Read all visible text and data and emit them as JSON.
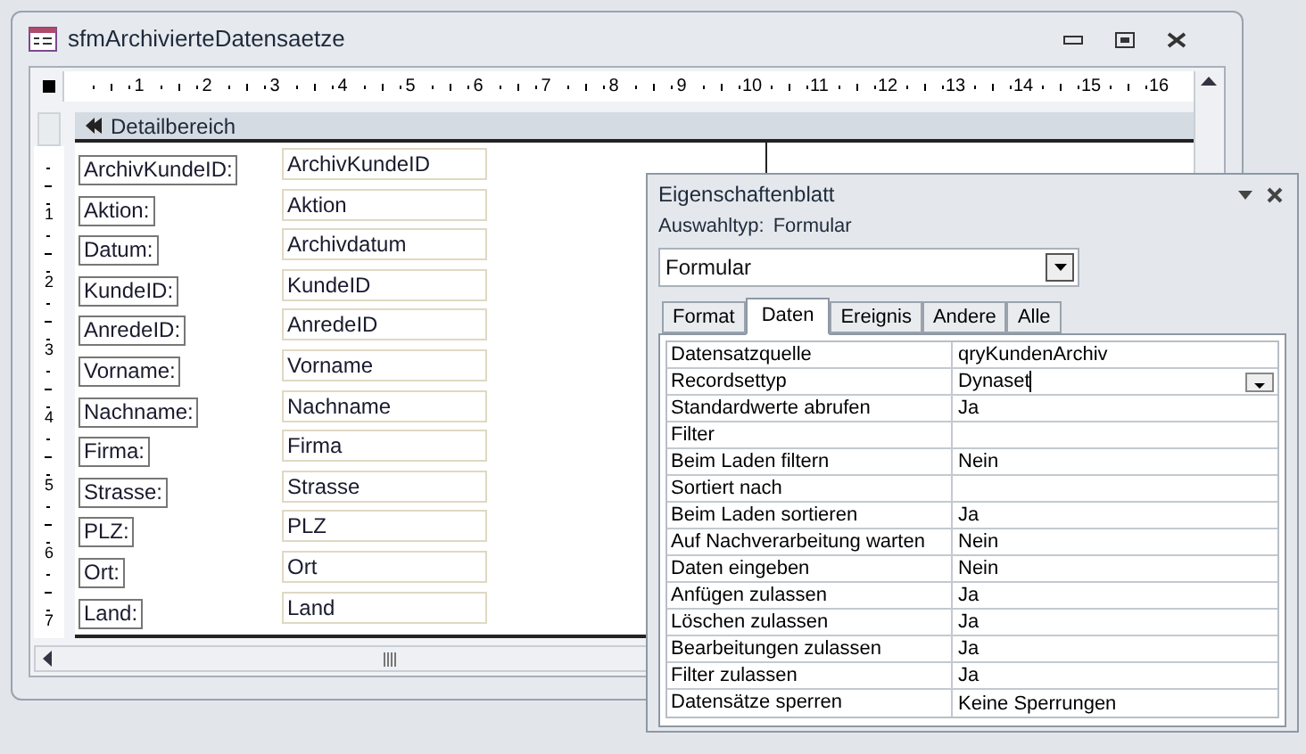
{
  "form_window": {
    "title": "sfmArchivierteDatensaetze",
    "ruler_horizontal": [
      "1",
      "2",
      "3",
      "4",
      "5",
      "6",
      "7",
      "8",
      "9",
      "10",
      "11",
      "12",
      "13",
      "14",
      "15",
      "16"
    ],
    "ruler_vertical": [
      "1",
      "2",
      "3",
      "4",
      "5",
      "6",
      "7"
    ],
    "section_header": "Detailbereich",
    "fields": [
      {
        "label": "ArchivKundeID:",
        "control": "ArchivKundeID"
      },
      {
        "label": "Aktion:",
        "control": "Aktion"
      },
      {
        "label": "Datum:",
        "control": "Archivdatum"
      },
      {
        "label": "KundeID:",
        "control": "KundeID"
      },
      {
        "label": "AnredeID:",
        "control": "AnredeID"
      },
      {
        "label": "Vorname:",
        "control": "Vorname"
      },
      {
        "label": "Nachname:",
        "control": "Nachname"
      },
      {
        "label": "Firma:",
        "control": "Firma"
      },
      {
        "label": "Strasse:",
        "control": "Strasse"
      },
      {
        "label": "PLZ:",
        "control": "PLZ"
      },
      {
        "label": "Ort:",
        "control": "Ort"
      },
      {
        "label": "Land:",
        "control": "Land"
      }
    ]
  },
  "property_sheet": {
    "title": "Eigenschaftenblatt",
    "selection_type_label": "Auswahltyp:",
    "selection_type": "Formular",
    "object_select": "Formular",
    "tabs": [
      {
        "label": "Format",
        "selected": false
      },
      {
        "label": "Daten",
        "selected": true
      },
      {
        "label": "Ereignis",
        "selected": false
      },
      {
        "label": "Andere",
        "selected": false
      },
      {
        "label": "Alle",
        "selected": false
      }
    ],
    "properties": [
      {
        "name": "Datensatzquelle",
        "value": "qryKundenArchiv",
        "kind": "text",
        "focused": false
      },
      {
        "name": "Recordsettyp",
        "value": "Dynaset",
        "kind": "dropdown",
        "focused": true
      },
      {
        "name": "Standardwerte abrufen",
        "value": "Ja",
        "kind": "text",
        "focused": false
      },
      {
        "name": "Filter",
        "kind": "text",
        "focused": false
      },
      {
        "name": "Beim Laden filtern",
        "value": "Nein",
        "kind": "text",
        "focused": false
      },
      {
        "name": "Sortiert nach",
        "kind": "text",
        "focused": false
      },
      {
        "name": "Beim Laden sortieren",
        "value": "Ja",
        "kind": "text",
        "focused": false
      },
      {
        "name": "Auf Nachverarbeitung warten",
        "value": "Nein",
        "kind": "text",
        "focused": false
      },
      {
        "name": "Daten eingeben",
        "value": "Nein",
        "kind": "text",
        "focused": false
      },
      {
        "name": "Anfügen zulassen",
        "value": "Ja",
        "kind": "text",
        "focused": false
      },
      {
        "name": "Löschen zulassen",
        "value": "Ja",
        "kind": "text",
        "focused": false
      },
      {
        "name": "Bearbeitungen zulassen",
        "value": "Ja",
        "kind": "text",
        "focused": false
      },
      {
        "name": "Filter zulassen",
        "value": "Ja",
        "kind": "text",
        "focused": false
      },
      {
        "name": "Datensätze sperren",
        "value": "Keine Sperrungen",
        "kind": "text",
        "focused": false
      }
    ]
  }
}
